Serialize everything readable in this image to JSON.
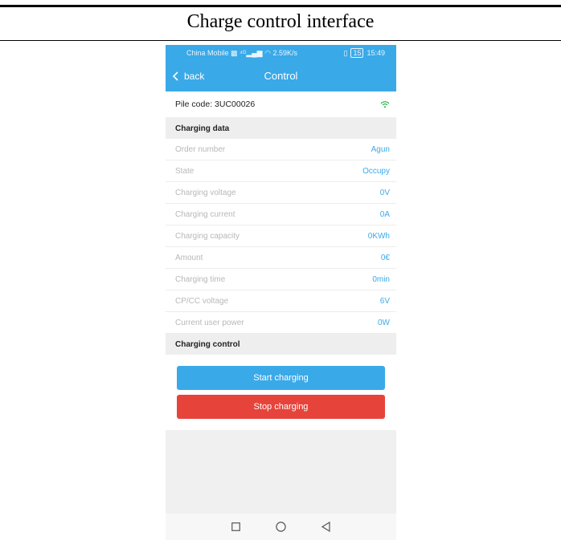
{
  "caption": "Charge control interface",
  "status_bar": {
    "carrier": "China Mobile",
    "speed": "2.59K/s",
    "battery": "15",
    "time": "15:49"
  },
  "navbar": {
    "back_label": "back",
    "title": "Control"
  },
  "pile": {
    "label": "Pile code: 3UC00026",
    "icon": "wifi-icon",
    "icon_color": "#2db84b"
  },
  "charging_data": {
    "title": "Charging data",
    "rows": [
      {
        "label": "Order number",
        "value": "Agun"
      },
      {
        "label": "State",
        "value": "Occupy"
      },
      {
        "label": "Charging voltage",
        "value": "0V"
      },
      {
        "label": "Charging current",
        "value": "0A"
      },
      {
        "label": "Charging capacity",
        "value": "0KWh"
      },
      {
        "label": "Amount",
        "value": "0€"
      },
      {
        "label": "Charging time",
        "value": "0min"
      },
      {
        "label": "CP/CC voltage",
        "value": "6V"
      },
      {
        "label": "Current user power",
        "value": "0W"
      }
    ]
  },
  "charging_control": {
    "title": "Charging control",
    "start_label": "Start charging",
    "stop_label": "Stop charging"
  },
  "colors": {
    "accent": "#3aa9e8",
    "stop": "#e6443b"
  },
  "nav_keys": [
    "square-icon",
    "circle-icon",
    "triangle-back-icon"
  ]
}
